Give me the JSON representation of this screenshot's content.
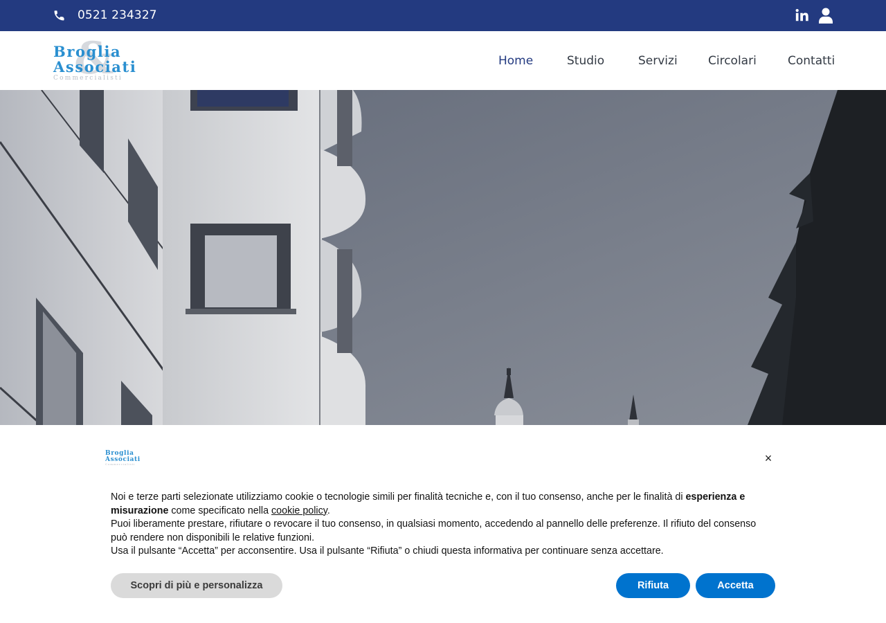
{
  "topbar": {
    "phone": "0521 234327",
    "phone_icon": "phone-icon",
    "social_icon": "linkedin-icon",
    "account_icon": "user-icon"
  },
  "header": {
    "logo": {
      "line1": "Broglia",
      "line2": "Associati",
      "line3": "Commercialisti",
      "ampersand": "&"
    },
    "nav": [
      {
        "label": "Home",
        "active": true
      },
      {
        "label": "Studio",
        "active": false
      },
      {
        "label": "Servizi",
        "active": false
      },
      {
        "label": "Circolari",
        "active": false
      },
      {
        "label": "Contatti",
        "active": false
      }
    ]
  },
  "cookie_banner": {
    "close_label": "×",
    "text_1a": "Noi e terze parti selezionate utilizziamo cookie o tecnologie simili per finalità tecniche e, con il tuo consenso, anche per le finalità di ",
    "text_1b": "esperienza e misurazione",
    "text_1c": " come specificato nella ",
    "text_1_link": "cookie policy",
    "text_1d": ".",
    "text_2": "Puoi liberamente prestare, rifiutare o revocare il tuo consenso, in qualsiasi momento, accedendo al pannello delle preferenze. Il rifiuto del consenso può rendere non disponibili le relative funzioni.",
    "text_3": "Usa il pulsante “Accetta” per acconsentire. Usa il pulsante “Rifiuta” o chiudi questa informativa per continuare senza accettare.",
    "btn_more": "Scopri di più e personalizza",
    "btn_reject": "Rifiuta",
    "btn_accept": "Accetta"
  },
  "colors": {
    "topbar_bg": "#233a80",
    "brand_blue": "#2a8fd0",
    "button_blue": "#0073ce",
    "button_grey": "#dadada"
  }
}
